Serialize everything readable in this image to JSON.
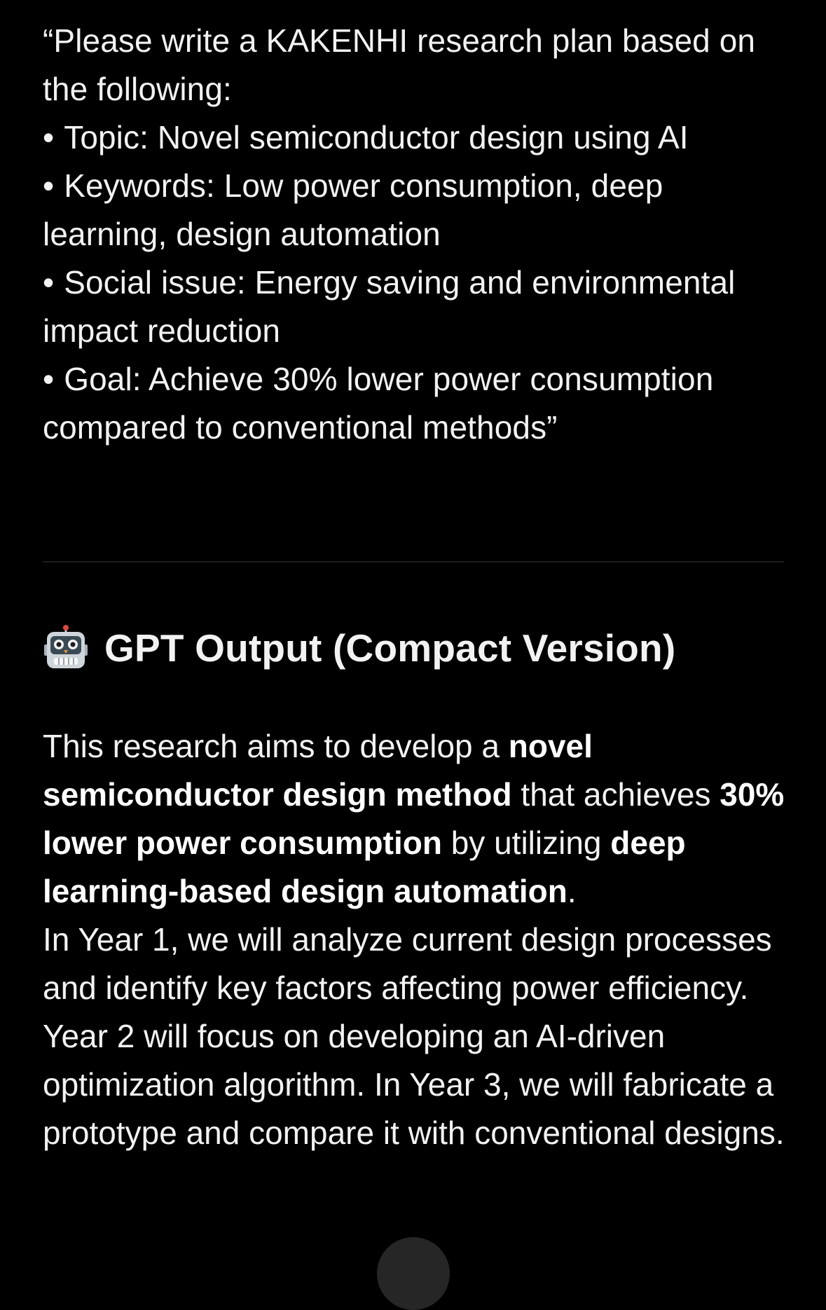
{
  "prompt": {
    "intro": "“Please write a KAKENHI research plan based on the following:",
    "bullet_symbol": "•",
    "bullets": [
      "Topic: Novel semiconductor design using AI",
      "Keywords: Low power consumption, deep learning, design automation",
      "Social issue: Energy saving and environmental impact reduction",
      "Goal: Achieve 30% lower power consumption compared to conventional methods”"
    ]
  },
  "output": {
    "heading_icon": "robot-icon",
    "heading": "GPT Output (Compact Version)",
    "para1": {
      "t1": "This research aims to develop a ",
      "b1": "novel semiconductor design method",
      "t2": " that achieves ",
      "b2": "30% lower power consumption",
      "t3": " by utilizing ",
      "b3": "deep learning-based design automation",
      "t4": "."
    },
    "para2": "In Year 1, we will analyze current design processes and identify key factors affecting power efficiency. Year 2 will focus on developing an AI-driven optimization algorithm. In Year 3, we will fabricate a prototype and compare it with conventional designs."
  },
  "colors": {
    "background": "#000000",
    "text": "#f2f2f2",
    "divider": "#1e1e1e",
    "scroll_button": "#262626"
  }
}
